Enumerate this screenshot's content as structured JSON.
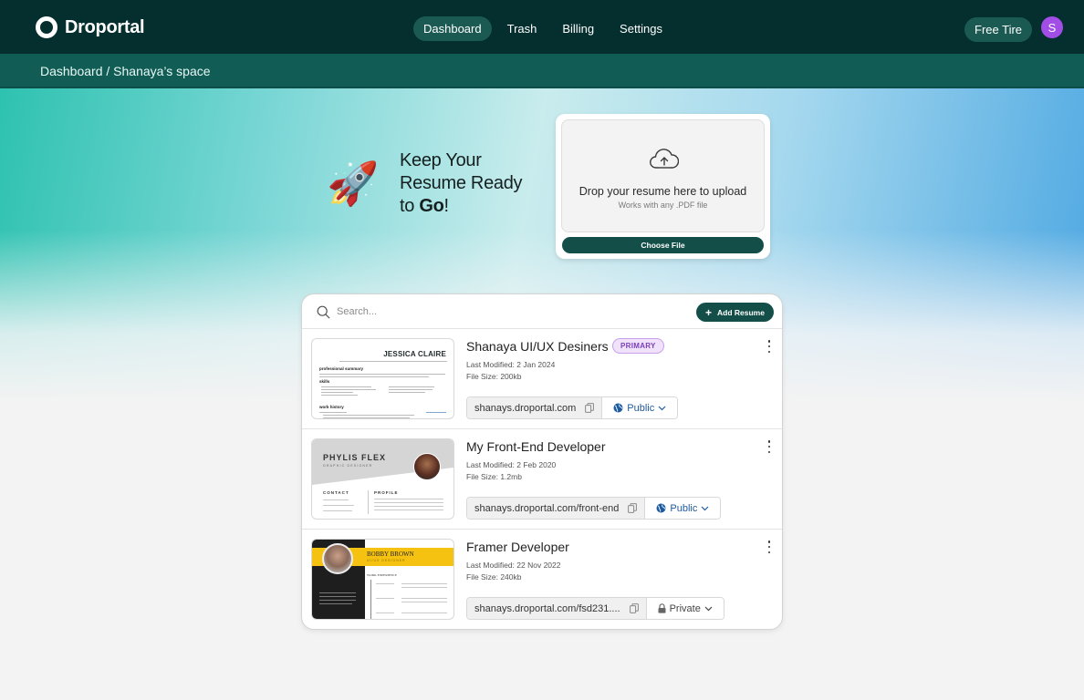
{
  "app": {
    "name": "Droportal"
  },
  "nav": {
    "items": [
      {
        "label": "Dashboard",
        "active": true
      },
      {
        "label": "Trash",
        "active": false
      },
      {
        "label": "Billing",
        "active": false
      },
      {
        "label": "Settings",
        "active": false
      }
    ],
    "plan_label": "Free Tire",
    "avatar_initial": "S"
  },
  "breadcrumb": "Dashboard / Shanaya’s space",
  "hero": {
    "icon": "rocket-icon",
    "line1": "Keep Your",
    "line2": "Resume Ready",
    "line3_prefix": "to ",
    "line3_bold": "Go",
    "line3_suffix": "!"
  },
  "upload": {
    "icon": "cloud-upload-icon",
    "title": "Drop your resume here to upload",
    "subtitle": "Works with any .PDF file",
    "button_label": "Choose File"
  },
  "resumes": {
    "search_placeholder": "Search...",
    "add_button_label": "Add Resume",
    "items": [
      {
        "title": "Shanaya UI/UX Desiners",
        "badge": "PRIMARY",
        "last_modified": "Last Modified: 2 Jan 2024",
        "file_size": "File Size: 200kb",
        "link": "shanays.droportal.com",
        "visibility": "Public",
        "thumbnail": {
          "name": "JESSICA CLAIRE",
          "sections": [
            "professional summary",
            "skills",
            "work history"
          ]
        }
      },
      {
        "title": "My Front-End Developer",
        "badge": "",
        "last_modified": "Last Modified: 2 Feb 2020",
        "file_size": "File Size: 1.2mb",
        "link": "shanays.droportal.com/front-end",
        "visibility": "Public",
        "thumbnail": {
          "name": "PHYLIS FLEX",
          "subtitle": "GRAPHIC DESIGNER",
          "sections": [
            "CONTACT",
            "PROFILE"
          ]
        }
      },
      {
        "title": "Framer Developer",
        "badge": "",
        "last_modified": "Last Modified: 22 Nov 2022",
        "file_size": "File Size: 240kb",
        "link": "shanays.droportal.com/fsd231....",
        "visibility": "Private",
        "thumbnail": {
          "name": "BOBBY BROWN",
          "subtitle": "UI/UX DESIGNER",
          "sections": [
            "WORK EXPERIENCE"
          ]
        }
      }
    ]
  },
  "colors": {
    "topbar": "#052e2e",
    "crumbbar": "#115d55",
    "primary_button": "#134f48",
    "avatar": "#a24de6",
    "badge_text": "#7a3fb8",
    "public_link": "#1d5a9e"
  }
}
